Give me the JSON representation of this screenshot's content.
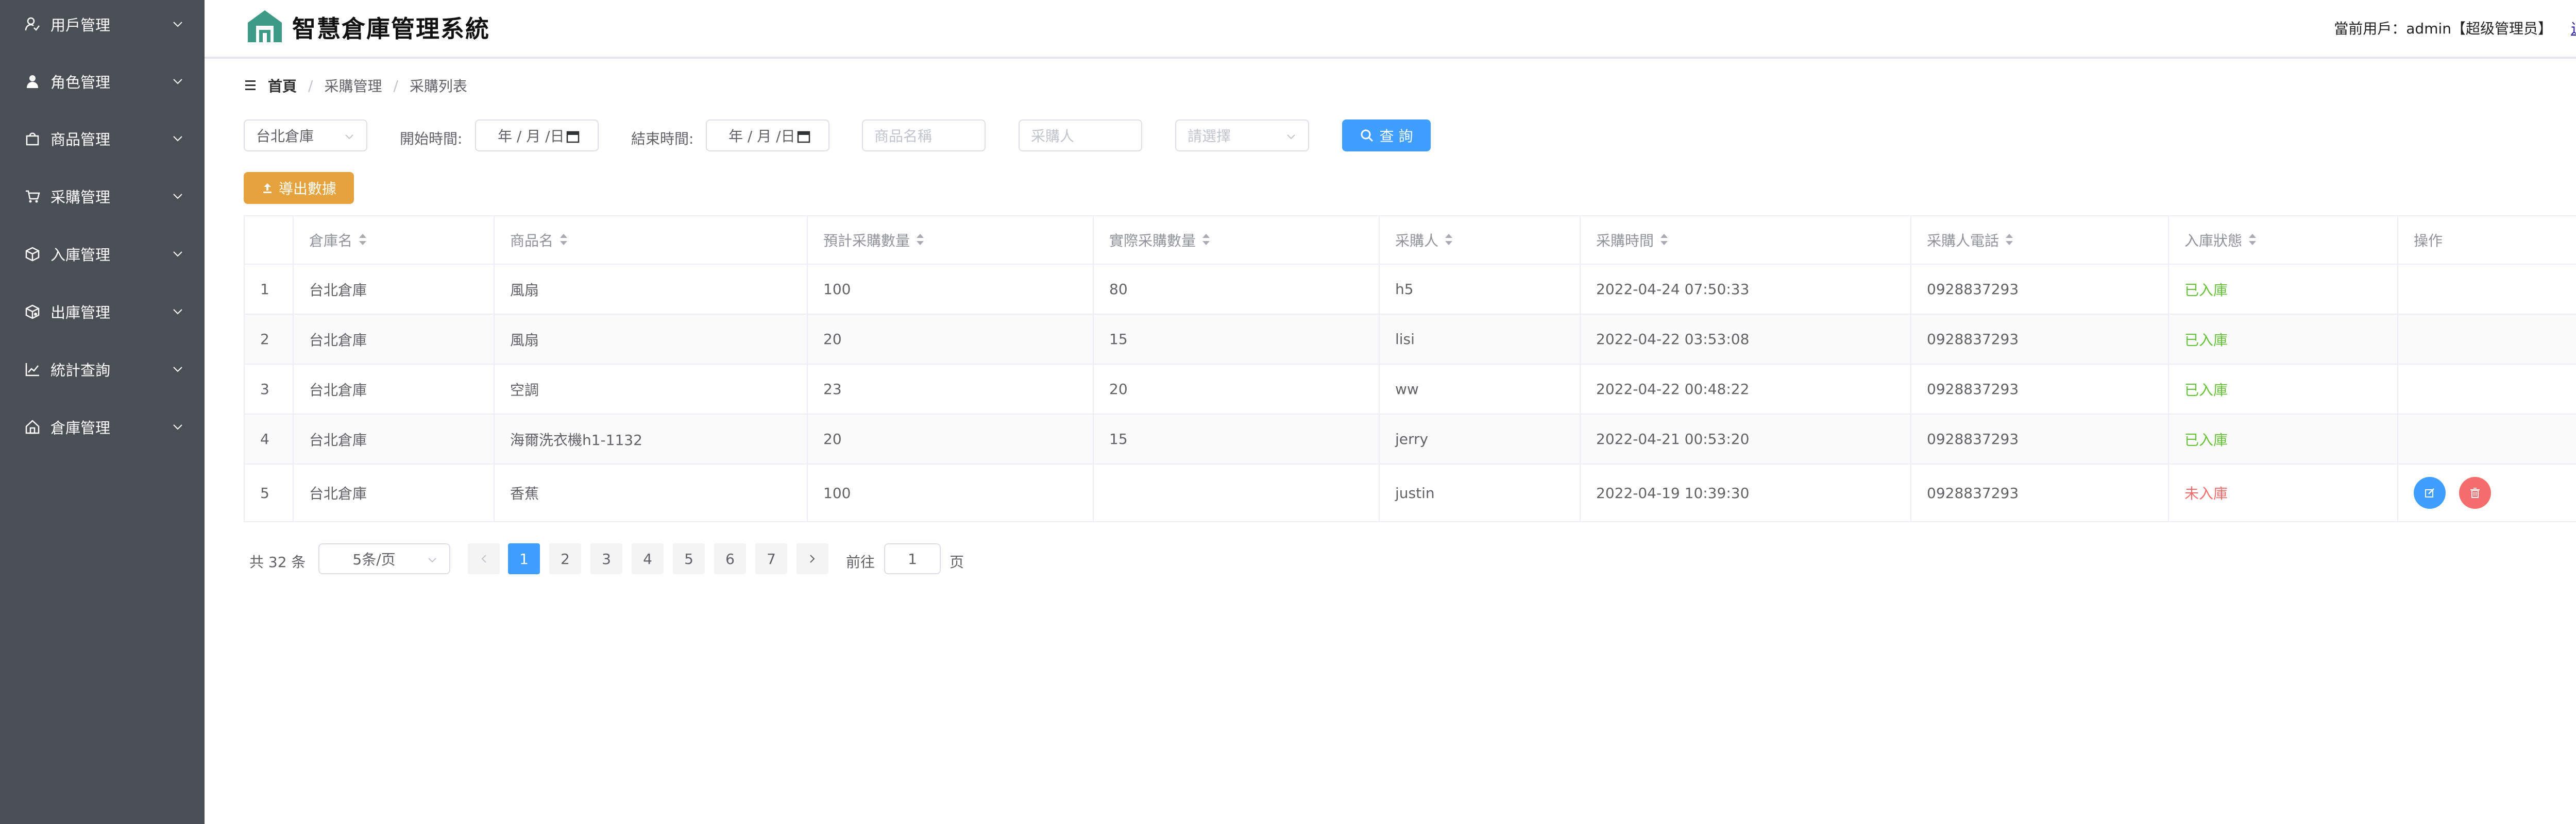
{
  "app": {
    "title": "智慧倉庫管理系統"
  },
  "header": {
    "user_info": "當前用戶：admin【超级管理员】",
    "logout": "退出"
  },
  "sidebar": {
    "items": [
      {
        "label": "用戶管理",
        "icon": "user-lock-icon"
      },
      {
        "label": "角色管理",
        "icon": "person-icon"
      },
      {
        "label": "商品管理",
        "icon": "shopping-bag-icon"
      },
      {
        "label": "采購管理",
        "icon": "shopping-cart-icon"
      },
      {
        "label": "入庫管理",
        "icon": "box-in-icon"
      },
      {
        "label": "出庫管理",
        "icon": "box-out-icon"
      },
      {
        "label": "統計查詢",
        "icon": "chart-icon"
      },
      {
        "label": "倉庫管理",
        "icon": "home-icon"
      }
    ]
  },
  "breadcrumb": {
    "home": "首頁",
    "level1": "采購管理",
    "level2": "采購列表",
    "sep": "/"
  },
  "filters": {
    "warehouse": "台北倉庫",
    "start_label": "開始時間:",
    "start_value": "年 / 月 /日",
    "end_label": "結束時間:",
    "end_value": "年 / 月 /日",
    "product_placeholder": "商品名稱",
    "buyer_placeholder": "采購人",
    "status_placeholder": "請選擇",
    "query_button": "查 詢",
    "export_button": "導出數據"
  },
  "table": {
    "headers": [
      "倉庫名",
      "商品名",
      "預計采購數量",
      "實際采購數量",
      "采購人",
      "采購時間",
      "采購人電話",
      "入庫狀態",
      "操作"
    ],
    "rows": [
      {
        "index": "1",
        "warehouse": "台北倉庫",
        "product": "風扇",
        "planned": "100",
        "actual": "80",
        "buyer": "h5",
        "time": "2022-04-24 07:50:33",
        "phone": "0928837293",
        "status": "已入庫"
      },
      {
        "index": "2",
        "warehouse": "台北倉庫",
        "product": "風扇",
        "planned": "20",
        "actual": "15",
        "buyer": "lisi",
        "time": "2022-04-22 03:53:08",
        "phone": "0928837293",
        "status": "已入庫"
      },
      {
        "index": "3",
        "warehouse": "台北倉庫",
        "product": "空調",
        "planned": "23",
        "actual": "20",
        "buyer": "ww",
        "time": "2022-04-22 00:48:22",
        "phone": "0928837293",
        "status": "已入庫"
      },
      {
        "index": "4",
        "warehouse": "台北倉庫",
        "product": "海爾洗衣機h1-1132",
        "planned": "20",
        "actual": "15",
        "buyer": "jerry",
        "time": "2022-04-21 00:53:20",
        "phone": "0928837293",
        "status": "已入庫"
      },
      {
        "index": "5",
        "warehouse": "台北倉庫",
        "product": "香蕉",
        "planned": "100",
        "actual": "",
        "buyer": "justin",
        "time": "2022-04-19 10:39:30",
        "phone": "0928837293",
        "status": "未入庫"
      }
    ]
  },
  "pagination": {
    "total": "共 32 条",
    "page_size": "5条/页",
    "pages": [
      "1",
      "2",
      "3",
      "4",
      "5",
      "6",
      "7"
    ],
    "current": "1",
    "goto_label": "前往",
    "goto_value": "1",
    "goto_unit": "页"
  },
  "colors": {
    "primary": "#409eff",
    "warning": "#e6a23c",
    "success": "#67c23a",
    "danger": "#f56c6c",
    "sidebar": "#4a4f56"
  }
}
